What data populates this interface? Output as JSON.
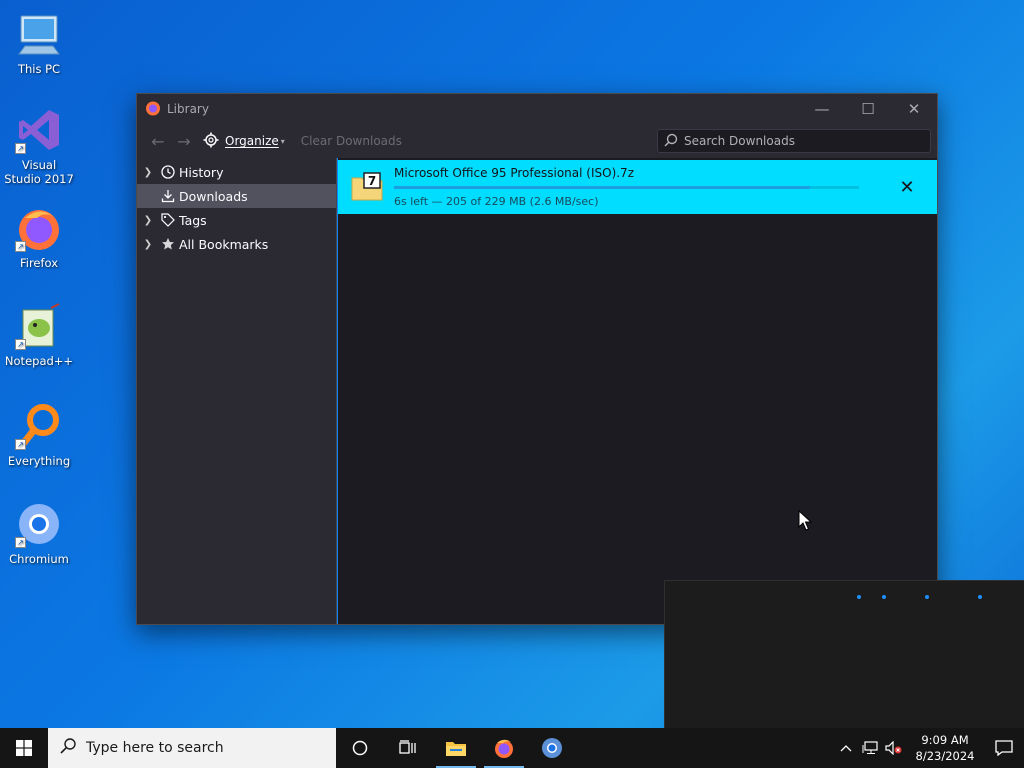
{
  "desktop": {
    "icons": [
      {
        "label": "This PC"
      },
      {
        "label": "Visual Studio 2017"
      },
      {
        "label": "Firefox"
      },
      {
        "label": "Notepad++"
      },
      {
        "label": "Everything"
      },
      {
        "label": "Chromium"
      }
    ]
  },
  "window": {
    "title": "Library",
    "toolbar": {
      "organize": "Organize",
      "clear_downloads": "Clear Downloads",
      "search_placeholder": "Search Downloads"
    },
    "sidebar": {
      "items": [
        {
          "label": "History"
        },
        {
          "label": "Downloads"
        },
        {
          "label": "Tags"
        },
        {
          "label": "All Bookmarks"
        }
      ]
    },
    "download": {
      "name": "Microsoft Office 95 Professional (ISO).7z",
      "status": "6s left — 205 of 229 MB (2.6 MB/sec)",
      "progress": 0.895
    }
  },
  "taskbar": {
    "search_placeholder": "Type here to search",
    "time": "9:09 AM",
    "date": "8/23/2024"
  },
  "colors": {
    "download_highlight": "#00ddff",
    "window_bg": "#1c1b22",
    "desktop_accent": "#0b78e3"
  }
}
